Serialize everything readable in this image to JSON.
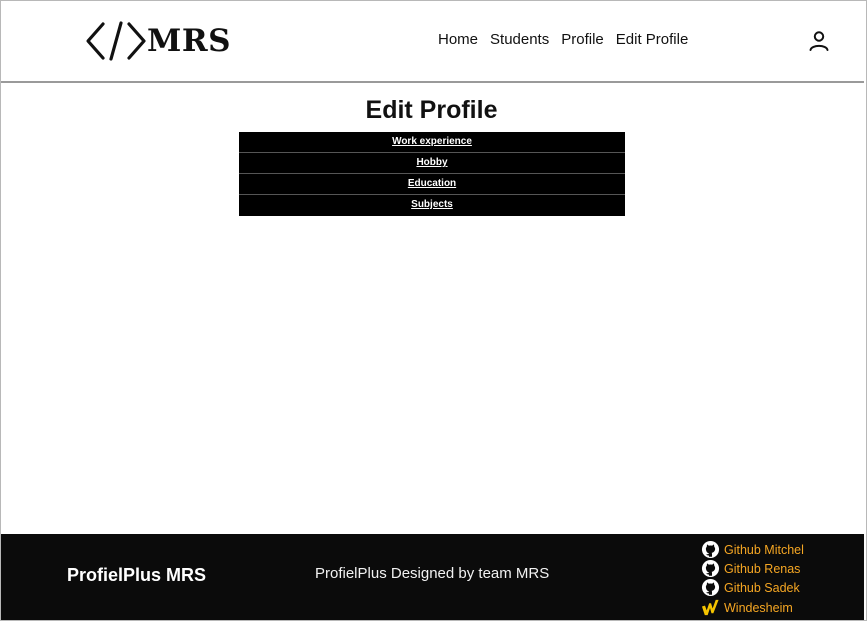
{
  "header": {
    "logo_text": "MRS",
    "logo_icon": "code-brackets-icon",
    "nav": [
      "Home",
      "Students",
      "Profile",
      "Edit Profile"
    ],
    "user_icon": "user-icon"
  },
  "main": {
    "title": "Edit Profile",
    "menu": [
      "Work experience",
      "Hobby",
      "Education",
      "Subjects"
    ]
  },
  "footer": {
    "brand": "ProfielPlus MRS",
    "credit": "ProfielPlus Designed by team MRS",
    "links": [
      {
        "label": "Github Mitchel",
        "icon": "github-icon"
      },
      {
        "label": "Github Renas",
        "icon": "github-icon"
      },
      {
        "label": "Github Sadek",
        "icon": "github-icon"
      },
      {
        "label": "Windesheim",
        "icon": "windesheim-icon"
      }
    ],
    "link_color": "#f5a623",
    "background": "#0b0b0b"
  }
}
